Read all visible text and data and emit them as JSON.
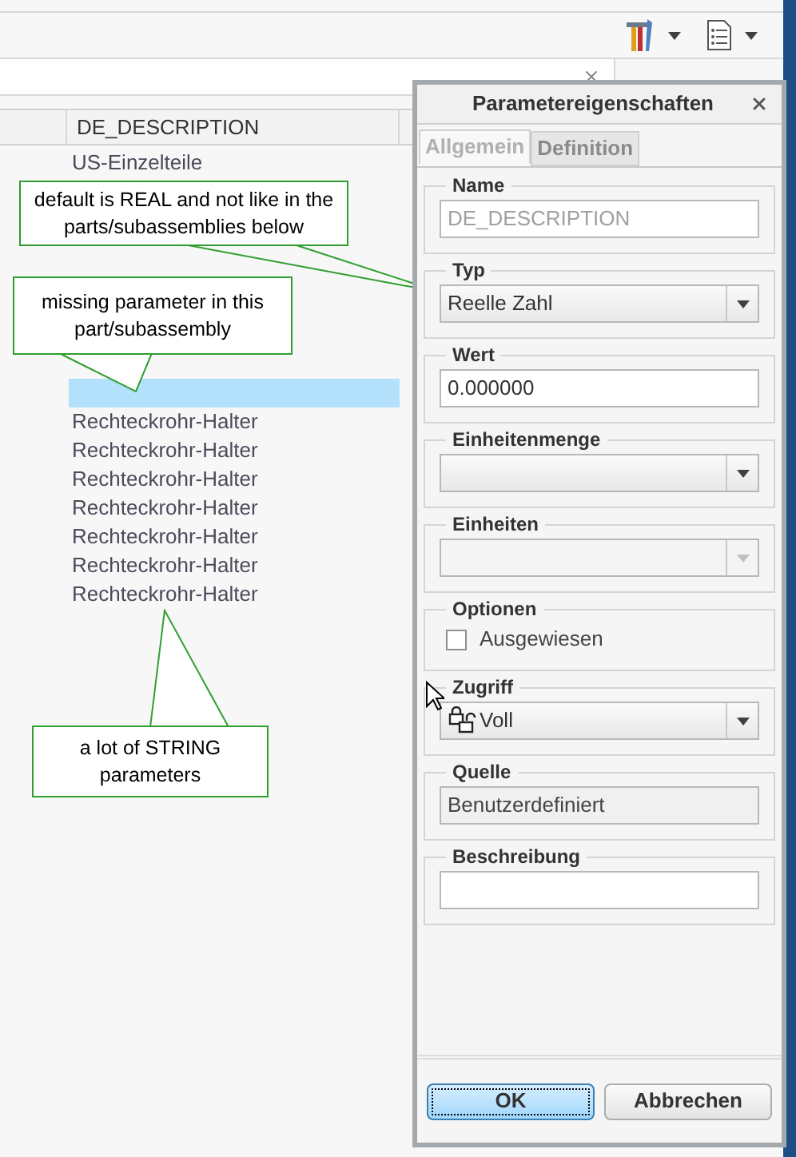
{
  "table": {
    "columns": [
      "DE_DESCRIPTION"
    ],
    "rows": [
      {
        "description": "US-Einzelteile",
        "selected": false
      },
      {
        "selected": false
      },
      {
        "selected": false
      },
      {
        "selected": false
      },
      {
        "selected": false
      },
      {
        "selected": false
      },
      {
        "selected": false
      },
      {
        "selected": false
      },
      {
        "selected": true
      },
      {
        "description": "Rechteckrohr-Halter",
        "selected": false
      },
      {
        "description": "Rechteckrohr-Halter",
        "selected": false
      },
      {
        "description": "Rechteckrohr-Halter",
        "selected": false
      },
      {
        "description": "Rechteckrohr-Halter",
        "selected": false
      },
      {
        "description": "Rechteckrohr-Halter",
        "selected": false
      },
      {
        "description": "Rechteckrohr-Halter",
        "selected": false
      },
      {
        "description": "Rechteckrohr-Halter",
        "selected": false
      }
    ]
  },
  "callouts": [
    {
      "text": "default is REAL and not like in the\nparts/subassemblies below"
    },
    {
      "text": "missing parameter in this\npart/subassembly"
    },
    {
      "text": "a lot of STRING\nparameters"
    }
  ],
  "dialog": {
    "title": "Parametereigenschaften",
    "tabs": [
      {
        "label": "Allgemein",
        "selected": true
      },
      {
        "label": "Definition",
        "selected": false
      }
    ],
    "sections": [
      {
        "label": "Name",
        "kind": "text",
        "value": "DE_DESCRIPTION",
        "disabled": true
      },
      {
        "label": "Typ",
        "kind": "combo",
        "value": "Reelle Zahl",
        "disabled": false
      },
      {
        "label": "Wert",
        "kind": "text",
        "value": "0.000000",
        "disabled": false
      },
      {
        "label": "Einheitenmenge",
        "kind": "combo",
        "disabled": false
      },
      {
        "label": "Einheiten",
        "kind": "combo",
        "disabled": true
      },
      {
        "label": "Optionen",
        "kind": "checkbox",
        "option": "Ausgewiesen",
        "checked": false
      },
      {
        "label": "Zugriff",
        "kind": "access",
        "value": "Voll",
        "disabled": false
      },
      {
        "label": "Quelle",
        "kind": "readonly",
        "value": "Benutzerdefiniert"
      },
      {
        "label": "Beschreibung",
        "kind": "text"
      }
    ],
    "buttons": [
      {
        "label": "OK",
        "default": true
      },
      {
        "label": "Abbrechen",
        "default": false
      }
    ]
  }
}
